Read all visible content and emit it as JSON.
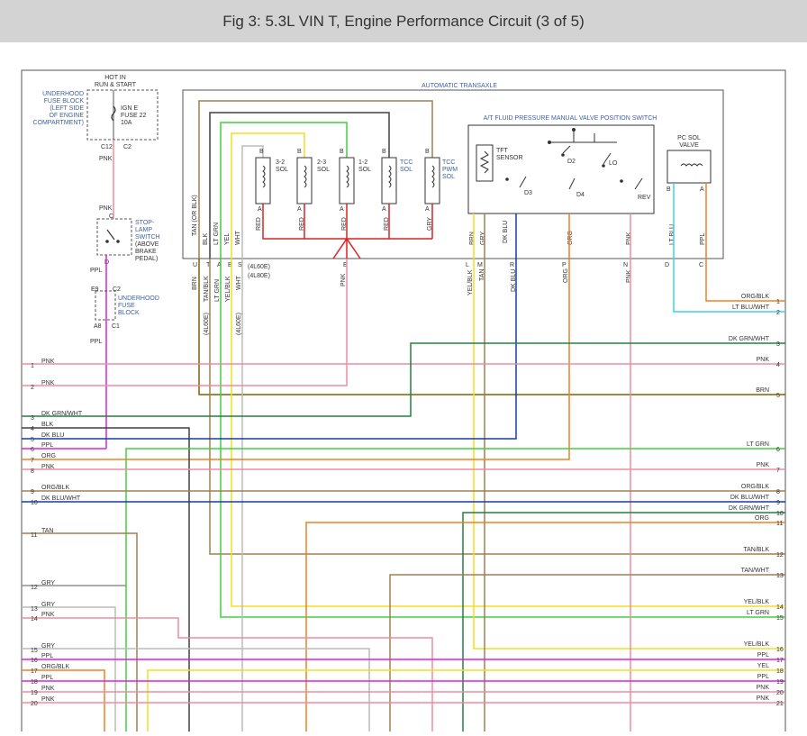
{
  "title": "Fig 3: 5.3L VIN T, Engine Performance Circuit (3 of 5)",
  "power": {
    "hot_line1": "HOT IN",
    "hot_line2": "RUN & START",
    "fuse_block_lines": [
      "UNDERHOOD",
      "FUSE BLOCK",
      "(LEFT SIDE",
      "OF ENGINE",
      "COMPARTMENT)"
    ],
    "fuse_lines": [
      "IGN E",
      "FUSE 22",
      "10A"
    ],
    "c12": "C12",
    "c2": "C2",
    "wire_pnk": "PNK"
  },
  "stoplamp": {
    "lines": [
      "STOP-",
      "LAMP",
      "SWITCH",
      "(ABOVE",
      "BRAKE",
      "PEDAL)"
    ],
    "pin_c": "C",
    "pin_d": "D",
    "wire_ppl": "PPL",
    "wire_pnk": "PNK"
  },
  "ufb2": {
    "lines": [
      "UNDERHOOD",
      "FUSE",
      "BLOCK"
    ],
    "e9": "E9",
    "c2": "C2",
    "a8": "A8",
    "c1": "C1",
    "wire_ppl": "PPL"
  },
  "transaxle": {
    "label": "AUTOMATIC TRANSAXLE",
    "left_wires": [
      "TAN (OR BLK)",
      "BLK",
      "LT GRN",
      "YEL",
      "WHT"
    ],
    "solenoids": [
      {
        "name": [
          "3-2",
          "SOL"
        ],
        "b": "B",
        "a": "A",
        "lead": "RED"
      },
      {
        "name": [
          "2-3",
          "SOL"
        ],
        "b": "B",
        "a": "A",
        "lead": "RED"
      },
      {
        "name": [
          "1-2",
          "SOL"
        ],
        "b": "B",
        "a": "A",
        "lead": "RED"
      },
      {
        "name": [
          "TCC",
          "SOL"
        ],
        "b": "B",
        "a": "A",
        "lead": "RED"
      },
      {
        "name": [
          "TCC",
          "PWM",
          "SOL"
        ],
        "b": "B",
        "a": "A",
        "lead": "GRY"
      }
    ],
    "switch_label": "A/T FLUID PRESSURE MANUAL VALVE POSITION SWITCH",
    "tft": [
      "TFT",
      "SENSOR"
    ],
    "positions": [
      "D2",
      "LO",
      "D3",
      "D4",
      "REV"
    ],
    "switch_wires": [
      "BRN",
      "GRY",
      "DK BLU",
      "ORG",
      "PNK"
    ],
    "pc_sol": [
      "PC SOL",
      "VALVE"
    ],
    "pc_pins": [
      "B",
      "A"
    ],
    "pc_wires": [
      "LT BLU",
      "PPL"
    ]
  },
  "connector": {
    "pins_left": [
      "U",
      "T",
      "A",
      "B",
      "S"
    ],
    "pin_e": "E",
    "model_notes": [
      "(4L60E)",
      "(4L80E)"
    ],
    "wires_left": [
      "BRN",
      "TAN/BLK",
      "LT GRN",
      "YEL/BLK",
      "WHT"
    ],
    "notes_left": [
      "(4L60E)",
      "(4L60E)"
    ],
    "wire_e": "PNK",
    "pins_right": [
      "L",
      "M",
      "R",
      "P",
      "N"
    ],
    "wires_right": [
      "YEL/BLK",
      "TAN",
      "DK BLU",
      "ORG",
      "PNK"
    ],
    "pins_pc": [
      "D",
      "C"
    ]
  },
  "left_terminals": [
    {
      "num": "1",
      "label": "PNK"
    },
    {
      "num": "2",
      "label": "PNK"
    },
    {
      "num": "3",
      "label": "DK GRN/WHT"
    },
    {
      "num": "4",
      "label": "BLK"
    },
    {
      "num": "5",
      "label": "DK BLU"
    },
    {
      "num": "6",
      "label": "PPL"
    },
    {
      "num": "7",
      "label": "ORG"
    },
    {
      "num": "8",
      "label": "PNK"
    },
    {
      "num": "9",
      "label": "ORG/BLK"
    },
    {
      "num": "10",
      "label": "DK BLU/WHT"
    },
    {
      "num": "11",
      "label": "TAN"
    },
    {
      "num": "12",
      "label": "GRY"
    },
    {
      "num": "13",
      "label": "GRY"
    },
    {
      "num": "14",
      "label": "PNK"
    },
    {
      "num": "15",
      "label": "GRY"
    },
    {
      "num": "16",
      "label": "PPL"
    },
    {
      "num": "17",
      "label": "ORG/BLK"
    },
    {
      "num": "18",
      "label": "PPL"
    },
    {
      "num": "19",
      "label": "PNK"
    },
    {
      "num": "20",
      "label": "PNK"
    }
  ],
  "right_terminals": [
    {
      "num": "1",
      "label": "ORG/BLK"
    },
    {
      "num": "2",
      "label": "LT BLU/WHT"
    },
    {
      "num": "3",
      "label": "DK GRN/WHT"
    },
    {
      "num": "4",
      "label": "PNK"
    },
    {
      "num": "5",
      "label": "BRN"
    },
    {
      "num": "6",
      "label": "LT GRN"
    },
    {
      "num": "7",
      "label": "PNK"
    },
    {
      "num": "8",
      "label": "ORG/BLK"
    },
    {
      "num": "9",
      "label": "DK BLU/WHT"
    },
    {
      "num": "10",
      "label": "DK GRN/WHT"
    },
    {
      "num": "11",
      "label": "ORG"
    },
    {
      "num": "12",
      "label": "TAN/BLK"
    },
    {
      "num": "13",
      "label": "TAN/WHT"
    },
    {
      "num": "14",
      "label": "YEL/BLK"
    },
    {
      "num": "15",
      "label": "LT GRN"
    },
    {
      "num": "16",
      "label": "YEL/BLK"
    },
    {
      "num": "17",
      "label": "PPL"
    },
    {
      "num": "18",
      "label": "YEL"
    },
    {
      "num": "19",
      "label": "PPL"
    },
    {
      "num": "20",
      "label": "PNK"
    },
    {
      "num": "21",
      "label": "PNK"
    }
  ],
  "colors": {
    "pnk": "#f08ca0",
    "ppl": "#e020e0",
    "brn": "#806000",
    "blk": "#404040",
    "dk_blu": "#1040a0",
    "dk_grn": "#208040",
    "lt_grn": "#40d040",
    "org": "#f08020",
    "tan": "#a08050",
    "yel": "#f0e020",
    "wht": "#bbbbbb",
    "red": "#e02020",
    "gry": "#909090",
    "lt_blu": "#40d0f0",
    "label_blue": "#4060a0"
  }
}
